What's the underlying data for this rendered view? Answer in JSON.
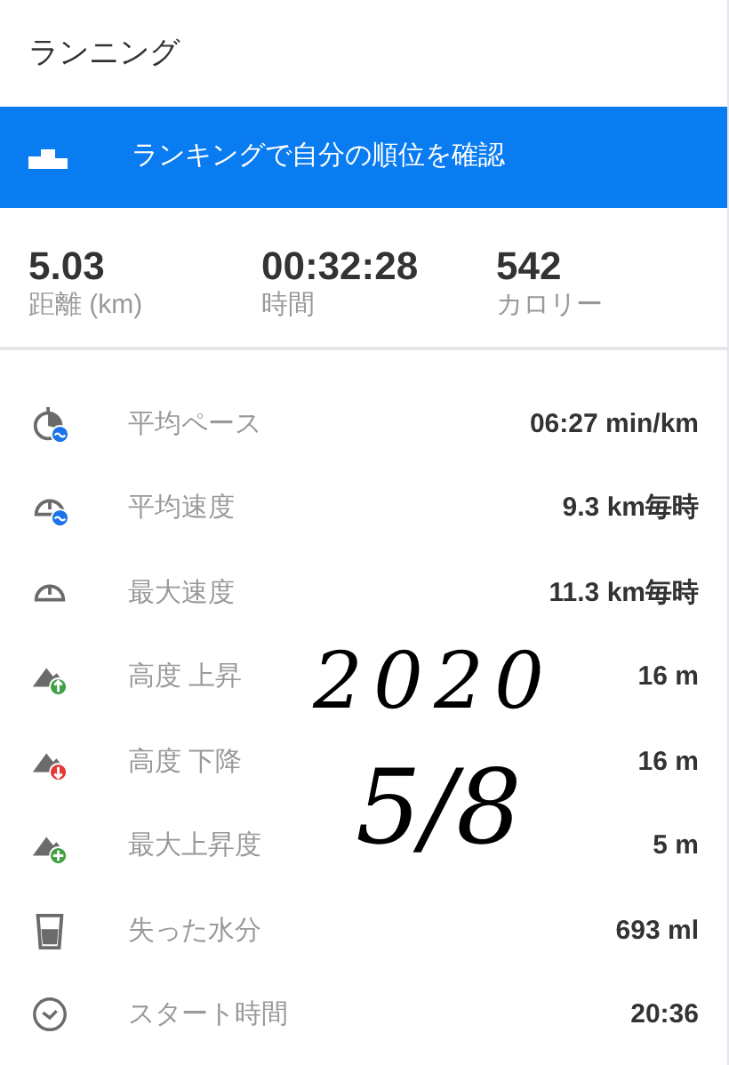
{
  "title": "ランニング",
  "banner": {
    "label": "ランキングで自分の順位を確認"
  },
  "summary": [
    {
      "value": "5.03",
      "label": "距離 (km)"
    },
    {
      "value": "00:32:28",
      "label": "時間"
    },
    {
      "value": "542",
      "label": "カロリー"
    }
  ],
  "metrics": [
    {
      "kind": "pace",
      "label": "平均ペース",
      "value": "06:27 min/km"
    },
    {
      "kind": "avg-speed",
      "label": "平均速度",
      "value": "9.3 km毎時"
    },
    {
      "kind": "max-speed",
      "label": "最大速度",
      "value": "11.3 km毎時"
    },
    {
      "kind": "ascent",
      "label": "高度 上昇",
      "value": "16 m"
    },
    {
      "kind": "descent",
      "label": "高度 下降",
      "value": "16 m"
    },
    {
      "kind": "max-ascent",
      "label": "最大上昇度",
      "value": "5 m"
    },
    {
      "kind": "water",
      "label": "失った水分",
      "value": "693 ml"
    },
    {
      "kind": "clock",
      "label": "スタート時間",
      "value": "20:36"
    }
  ],
  "handwritten_note": [
    "2020",
    "5/8"
  ]
}
